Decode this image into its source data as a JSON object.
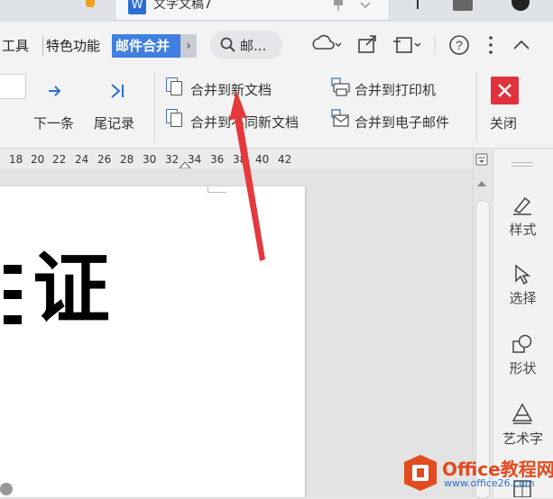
{
  "tabbar": {
    "doc_title": "文字文稿7",
    "doc_icon": "W"
  },
  "menu": {
    "items": [
      "工具",
      "特色功能"
    ],
    "active": "邮件合并",
    "more": "›",
    "search_placeholder": "邮..."
  },
  "ribbon": {
    "next_label": "下一条",
    "last_label": "尾记录",
    "merge_new_doc": "合并到新文档",
    "merge_diff_docs": "合并到不同新文档",
    "merge_printer": "合并到打印机",
    "merge_email": "合并到电子邮件",
    "close_label": "关闭"
  },
  "ruler": {
    "labels": [
      "18",
      "20",
      "22",
      "24",
      "26",
      "28",
      "30",
      "32",
      "34",
      "36",
      "38",
      "40",
      "42"
    ]
  },
  "document": {
    "visible_text": "证"
  },
  "right_panel": {
    "items": [
      "样式",
      "选择",
      "形状",
      "艺术字"
    ]
  },
  "watermark": {
    "name": "Office教程网",
    "url": "www.office26.com"
  },
  "colors": {
    "accent": "#3f7fe0",
    "close_red": "#e0323c",
    "arrow": "#e5393d",
    "logo_orange": "#e24b1f"
  }
}
